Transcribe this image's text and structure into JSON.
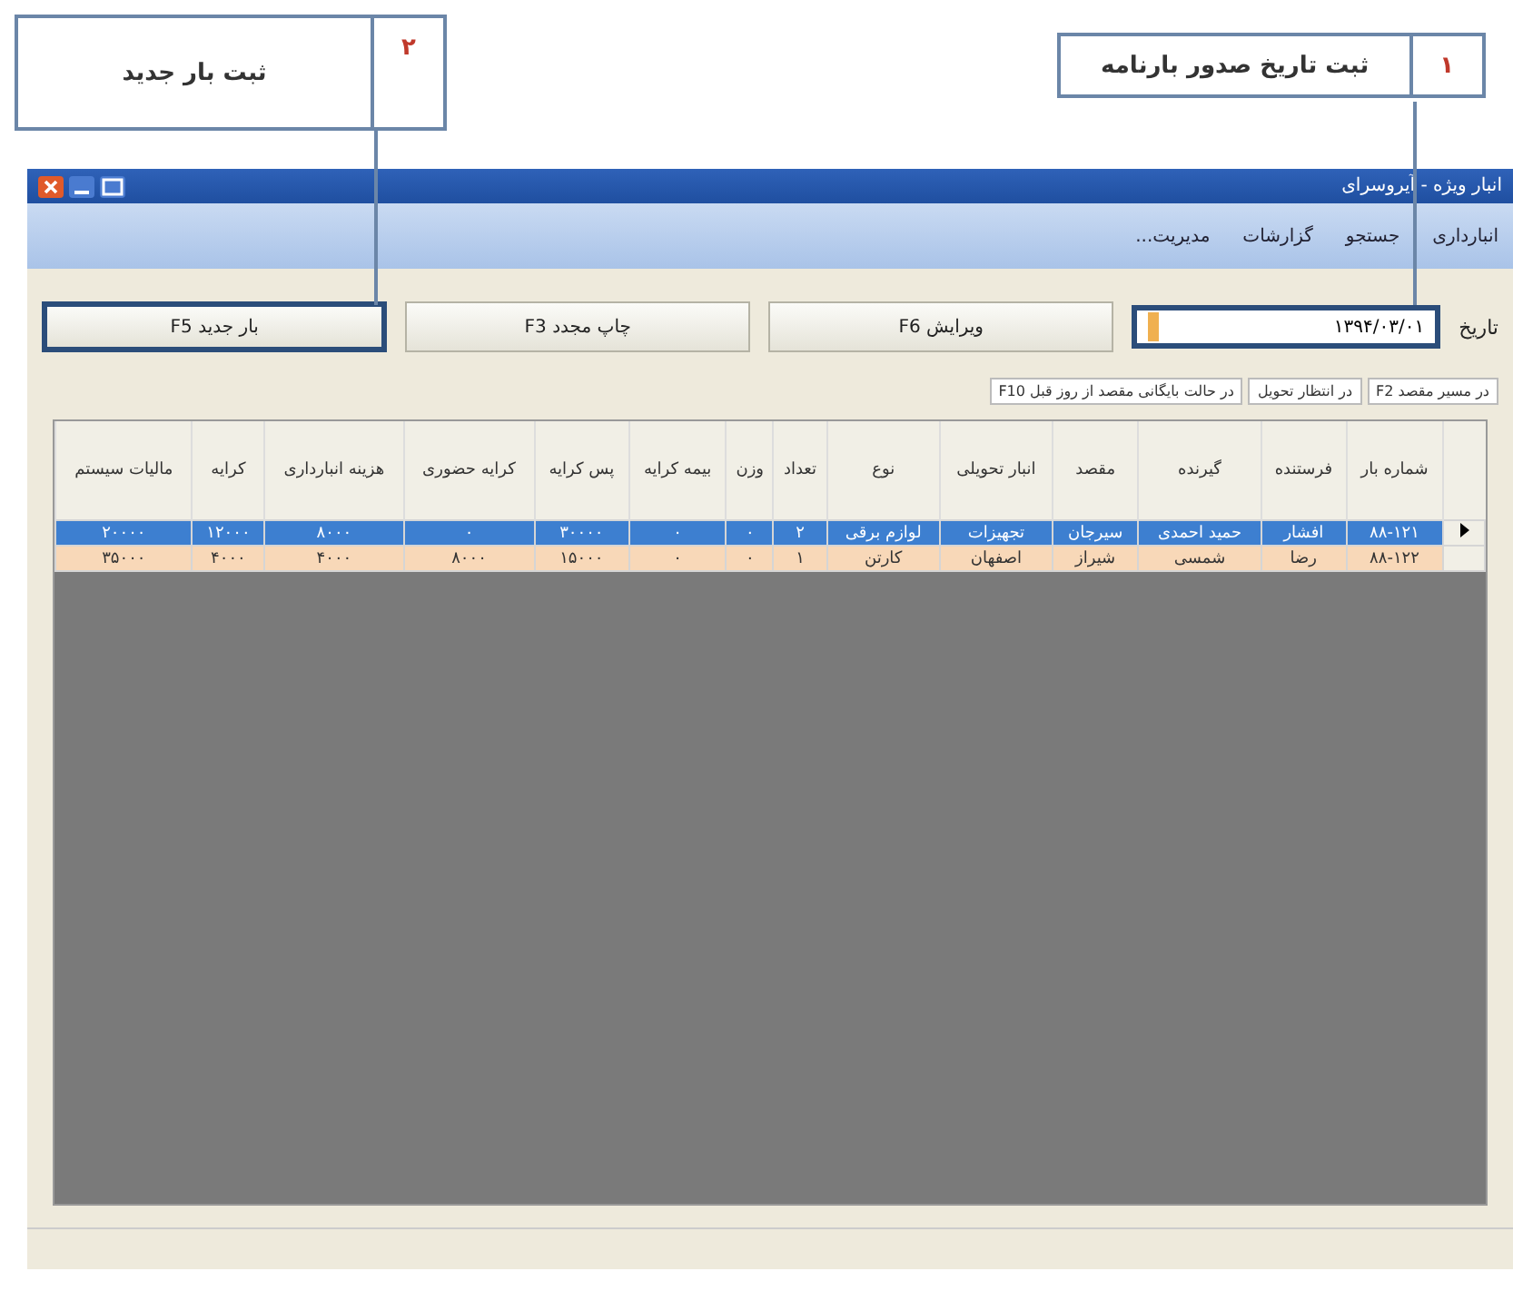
{
  "callouts": [
    {
      "number": "۱",
      "text": "ثبت تاریخ صدور بارنامه"
    },
    {
      "number": "۲",
      "text": "ثبت بار جدید"
    }
  ],
  "window": {
    "title": "انبار ویژه - آیروسرای"
  },
  "menu": [
    "انبارداری",
    "جستجو",
    "گزارشات",
    "مدیریت..."
  ],
  "date": {
    "label": "تاریخ",
    "value": "۱۳۹۴/۰۳/۰۱"
  },
  "buttons": [
    "ویرایش F6",
    "چاپ مجدد F3",
    "بار جدید F5"
  ],
  "legend": [
    "در مسیر مقصد F2",
    "در انتظار تحویل",
    "در حالت بایگانی مقصد از روز قبل F10"
  ],
  "table": {
    "columns": [
      "شماره بار",
      "فرستنده",
      "گیرنده",
      "مقصد",
      "انبار تحویلی",
      "نوع",
      "تعداد",
      "وزن",
      "بیمه کرایه",
      "پس کرایه",
      "کرایه حضوری",
      "هزینه انبارداری",
      "کرایه",
      "مالیات سیستم"
    ],
    "rows": [
      {
        "selected": true,
        "cells": [
          "۸۸-۱۲۱",
          "افشار",
          "حمید احمدی",
          "سیرجان",
          "تجهیزات",
          "لوازم برقی",
          "۲",
          "۰",
          "۰",
          "۳۰۰۰۰",
          "۰",
          "۸۰۰۰",
          "۱۲۰۰۰",
          "۲۰۰۰۰"
        ]
      },
      {
        "selected": false,
        "cells": [
          "۸۸-۱۲۲",
          "رضا",
          "شمسی",
          "شیراز",
          "اصفهان",
          "کارتن",
          "۱",
          "۰",
          "۰",
          "۱۵۰۰۰",
          "۸۰۰۰",
          "۴۰۰۰",
          "۴۰۰۰",
          "۳۵۰۰۰"
        ]
      }
    ]
  }
}
